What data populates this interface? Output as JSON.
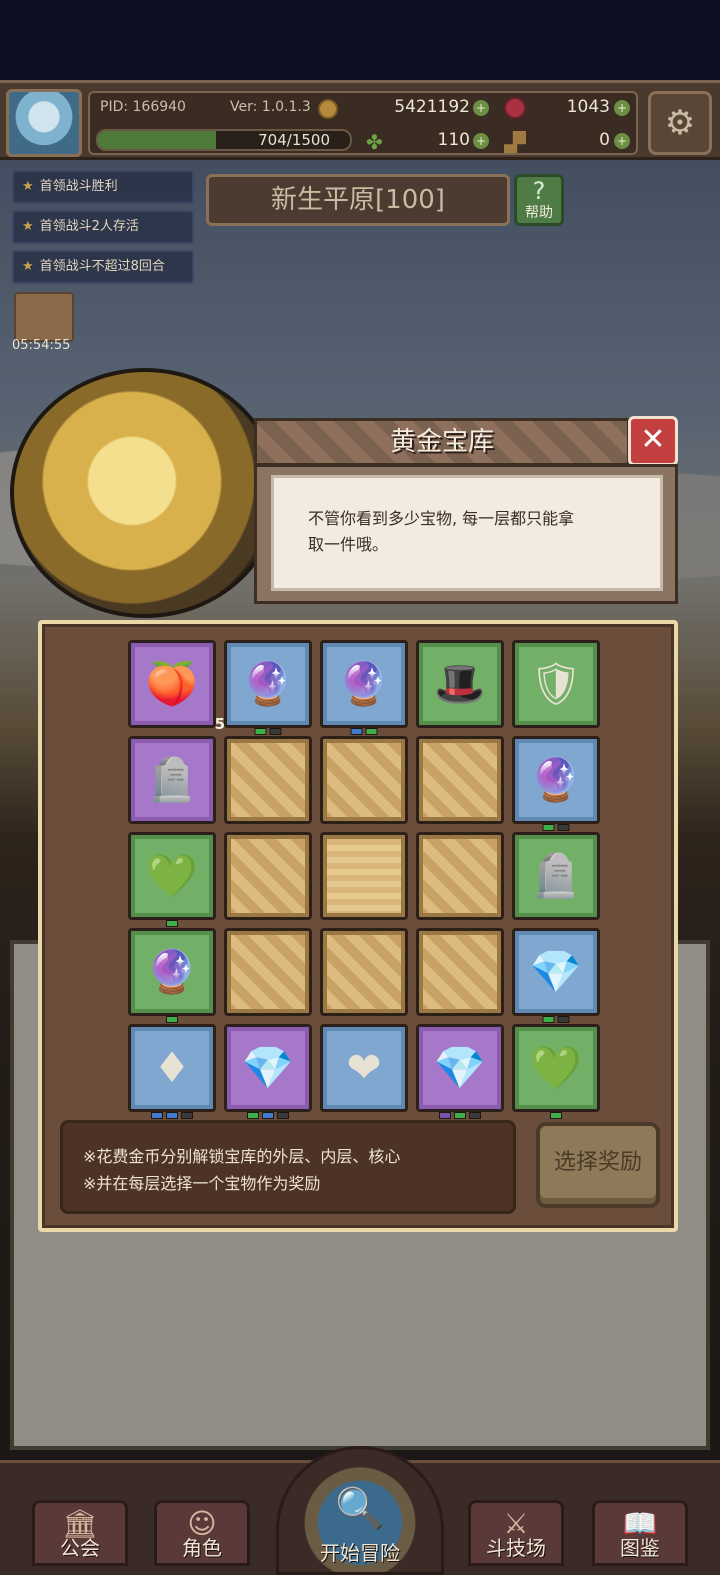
{
  "header": {
    "pid": "PID: 166940",
    "version": "Ver: 1.0.1.3",
    "gold": "5421192",
    "gems": "1043",
    "xp_text": "704/1500",
    "xp_fraction": 0.4693,
    "clover": "110",
    "keys": "0",
    "plus": "+"
  },
  "quests": [
    {
      "label": "首领战斗胜利"
    },
    {
      "label": "首领战斗2人存活"
    },
    {
      "label": "首领战斗不超过8回合"
    }
  ],
  "timer": "05:54:55",
  "stage": {
    "title": "新生平原[100]",
    "help_label": "帮助",
    "help_glyph": "?"
  },
  "dialog": {
    "title": "黄金宝库",
    "close_glyph": "✕",
    "message_line1": "不管你看到多少宝物, 每一层都只能拿",
    "message_line2": "取一件哦。",
    "note_line1": "※花费金币分别解锁宝库的外层、内层、核心",
    "note_line2": "※并在每层选择一个宝物作为奖励",
    "choose_button": "选择奖励"
  },
  "vault_cells": [
    {
      "kind": "purple",
      "icon": "fruit-icon",
      "glyph": "🍑",
      "count": "5",
      "dots": []
    },
    {
      "kind": "blue",
      "icon": "crystal-orb-icon",
      "glyph": "🔮",
      "count": "",
      "dots": [
        "#3fae4a",
        "#3a3a3a"
      ]
    },
    {
      "kind": "blue",
      "icon": "crystal-orb-icon",
      "glyph": "🔮",
      "count": "",
      "dots": [
        "#3f7ccf",
        "#3fae4a"
      ]
    },
    {
      "kind": "green",
      "icon": "hat-icon",
      "glyph": "🎩",
      "count": "",
      "dots": []
    },
    {
      "kind": "green",
      "icon": "shield-icon",
      "glyph": "🛡",
      "count": "",
      "dots": []
    },
    {
      "kind": "purple",
      "icon": "rune-tablet-icon",
      "glyph": "🪦",
      "count": "",
      "dots": []
    },
    {
      "kind": "gold",
      "icon": "locked-tile-icon",
      "glyph": "",
      "count": "",
      "dots": []
    },
    {
      "kind": "gold",
      "icon": "locked-tile-icon",
      "glyph": "",
      "count": "",
      "dots": []
    },
    {
      "kind": "gold",
      "icon": "locked-tile-icon",
      "glyph": "",
      "count": "",
      "dots": []
    },
    {
      "kind": "blue",
      "icon": "crystal-orb-icon",
      "glyph": "🔮",
      "count": "",
      "dots": [
        "#3fae4a",
        "#3a3a3a"
      ]
    },
    {
      "kind": "green",
      "icon": "green-gem-icon",
      "glyph": "💚",
      "count": "",
      "dots": [
        "#3fae4a"
      ]
    },
    {
      "kind": "gold",
      "icon": "locked-tile-icon",
      "glyph": "",
      "count": "",
      "dots": []
    },
    {
      "kind": "core",
      "icon": "vault-core-icon",
      "glyph": "",
      "count": "",
      "dots": []
    },
    {
      "kind": "gold",
      "icon": "locked-tile-icon",
      "glyph": "",
      "count": "",
      "dots": []
    },
    {
      "kind": "green",
      "icon": "rune-tablet-icon",
      "glyph": "🪦",
      "count": "",
      "dots": []
    },
    {
      "kind": "green",
      "icon": "crystal-orb-icon",
      "glyph": "🔮",
      "count": "",
      "dots": [
        "#3fae4a"
      ]
    },
    {
      "kind": "gold",
      "icon": "locked-tile-icon",
      "glyph": "",
      "count": "",
      "dots": []
    },
    {
      "kind": "gold",
      "icon": "locked-tile-icon",
      "glyph": "",
      "count": "",
      "dots": []
    },
    {
      "kind": "gold",
      "icon": "locked-tile-icon",
      "glyph": "",
      "count": "",
      "dots": []
    },
    {
      "kind": "blue",
      "icon": "white-diamond-icon",
      "glyph": "💎",
      "count": "",
      "dots": [
        "#3fae4a",
        "#3a3a3a"
      ]
    },
    {
      "kind": "blue",
      "icon": "ruby-icon",
      "glyph": "♦",
      "count": "",
      "dots": [
        "#3f7ccf",
        "#3f7ccf",
        "#3a3a3a"
      ]
    },
    {
      "kind": "purple",
      "icon": "white-diamond-icon",
      "glyph": "💎",
      "count": "",
      "dots": [
        "#3fae4a",
        "#3f7ccf",
        "#3a3a3a"
      ]
    },
    {
      "kind": "blue",
      "icon": "heart-tablet-icon",
      "glyph": "❤",
      "count": "",
      "dots": []
    },
    {
      "kind": "purple",
      "icon": "white-diamond-icon",
      "glyph": "💎",
      "count": "",
      "dots": [
        "#7a4fb0",
        "#3fae4a",
        "#3a3a3a"
      ]
    },
    {
      "kind": "green",
      "icon": "green-gem-icon",
      "glyph": "💚",
      "count": "",
      "dots": [
        "#3fae4a"
      ]
    }
  ],
  "nav": {
    "guild": "公会",
    "character": "角色",
    "start": "开始冒险",
    "arena": "斗技场",
    "codex": "图鉴"
  }
}
